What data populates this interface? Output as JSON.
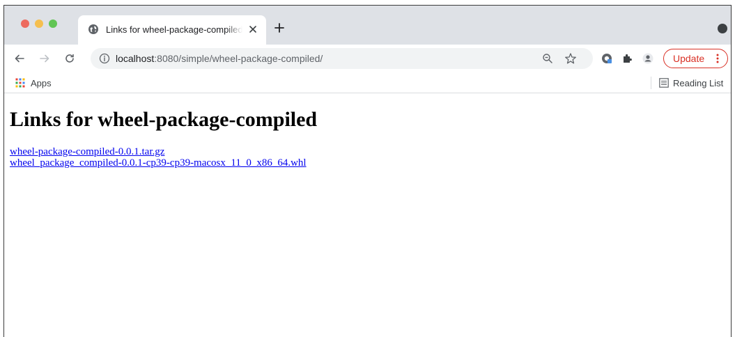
{
  "tab": {
    "title": "Links for wheel-package-compiled"
  },
  "omnibox": {
    "url_host": "localhost",
    "url_rest": ":8080/simple/wheel-package-compiled/"
  },
  "toolbar": {
    "update_label": "Update"
  },
  "bookmarks": {
    "apps_label": "Apps",
    "reading_list_label": "Reading List"
  },
  "page": {
    "heading": "Links for wheel-package-compiled",
    "links": [
      {
        "text": "wheel-package-compiled-0.0.1.tar.gz"
      },
      {
        "text": "wheel_package_compiled-0.0.1-cp39-cp39-macosx_11_0_x86_64.whl"
      }
    ]
  },
  "colors": {
    "update_accent": "#d93025",
    "link": "#0000ee",
    "tabstrip_bg": "#dee1e6"
  },
  "icons": [
    "globe-icon",
    "close-icon",
    "plus-icon",
    "back-arrow-icon",
    "forward-arrow-icon",
    "reload-icon",
    "info-icon",
    "zoom-icon",
    "star-icon",
    "extension-icon",
    "puzzle-icon",
    "account-icon",
    "kebab-menu-icon",
    "apps-grid-icon",
    "reading-list-icon"
  ]
}
